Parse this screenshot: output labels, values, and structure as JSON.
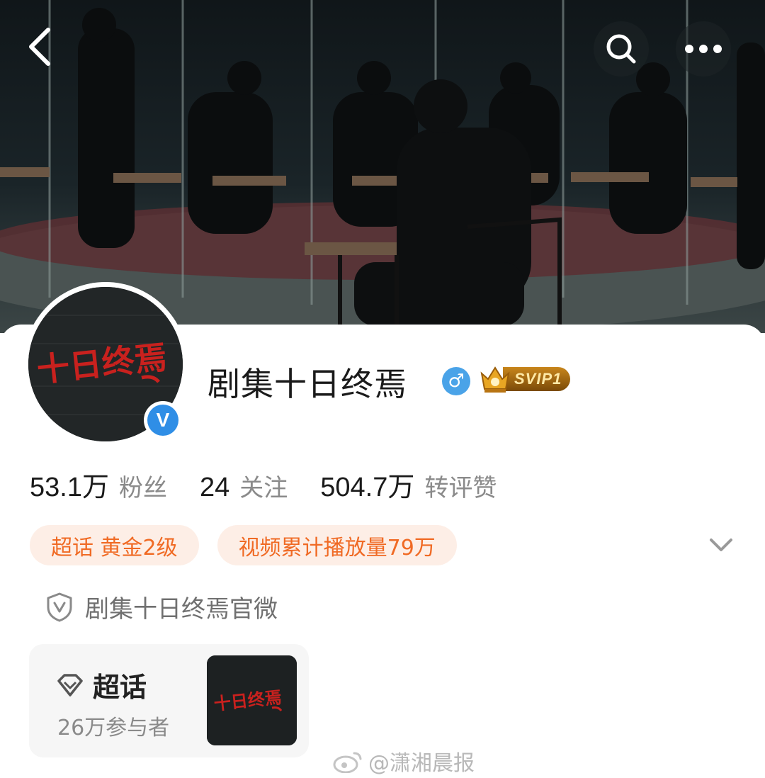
{
  "header": {
    "back_icon": "chevron-left-icon",
    "search_icon": "search-icon",
    "more_icon": "more-horizontal-icon"
  },
  "profile": {
    "name": "剧集十日终焉",
    "avatar_text": "十日终焉",
    "gender_symbol": "♂",
    "verified_symbol": "V",
    "vip_label": "SVIP1"
  },
  "stats": [
    {
      "value": "53.1万",
      "label": "粉丝"
    },
    {
      "value": "24",
      "label": "关注"
    },
    {
      "value": "504.7万",
      "label": "转评赞"
    }
  ],
  "tags": [
    "超话 黄金2级",
    "视频累计播放量79万"
  ],
  "official": {
    "label": "剧集十日终焉官微"
  },
  "topic": {
    "title": "超话",
    "participants": "26万参与者",
    "thumb_text": "十日终焉"
  },
  "watermark": {
    "text": "@潇湘晨报"
  },
  "colors": {
    "accent": "#f06a24",
    "tag_bg": "#fdeee6",
    "verified": "#2f8ee6",
    "gender": "#4aa3e8"
  }
}
